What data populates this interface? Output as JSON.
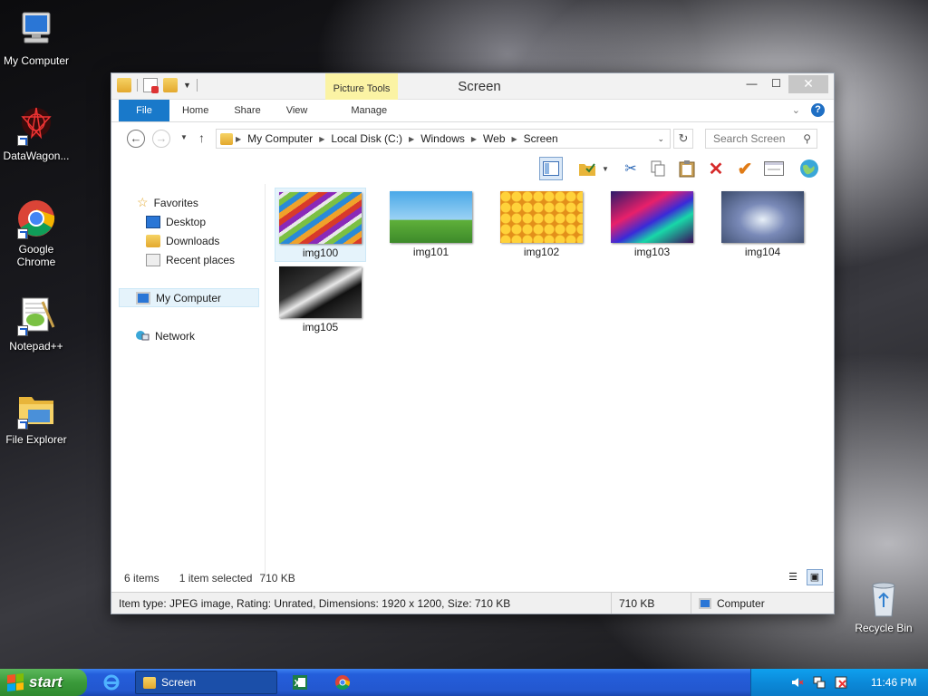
{
  "desktop": {
    "icons": [
      {
        "label": "My Computer"
      },
      {
        "label": "DataWagon..."
      },
      {
        "label": "Google Chrome"
      },
      {
        "label": "Notepad++"
      },
      {
        "label": "File Explorer"
      },
      {
        "label": "Recycle Bin"
      }
    ]
  },
  "window": {
    "title": "Screen",
    "context_tab": "Picture Tools",
    "ribbon_tabs": [
      "File",
      "Home",
      "Share",
      "View",
      "Manage"
    ],
    "address": [
      "My Computer",
      "Local Disk (C:)",
      "Windows",
      "Web",
      "Screen"
    ],
    "search_placeholder": "Search Screen",
    "nav": {
      "favorites": "Favorites",
      "desktop": "Desktop",
      "downloads": "Downloads",
      "recent": "Recent places",
      "my_computer": "My Computer",
      "network": "Network"
    },
    "files": [
      {
        "name": "img100"
      },
      {
        "name": "img101"
      },
      {
        "name": "img102"
      },
      {
        "name": "img103"
      },
      {
        "name": "img104"
      },
      {
        "name": "img105"
      }
    ],
    "status": {
      "count": "6 items",
      "selected": "1 item selected",
      "size": "710 KB"
    },
    "details": {
      "info": "Item type: JPEG image, Rating: Unrated, Dimensions: 1920 x 1200, Size: 710 KB",
      "size": "710 KB",
      "location": "Computer"
    }
  },
  "taskbar": {
    "start_label": "start",
    "task_label": "Screen",
    "clock": "11:46 PM"
  },
  "colors": {
    "accent": "#1979ca",
    "taskbar": "#245edb",
    "start": "#3a9a3a",
    "tray": "#0b8ad9"
  }
}
